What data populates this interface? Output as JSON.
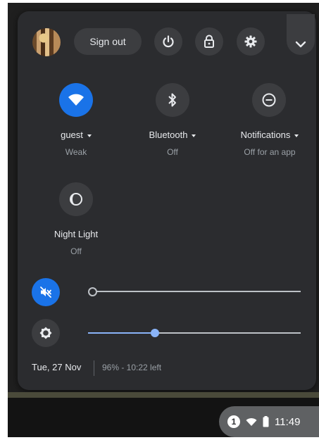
{
  "header": {
    "sign_out_label": "Sign out",
    "icons": [
      "avatar",
      "power-icon",
      "lock-icon",
      "gear-icon",
      "chevron-down-icon"
    ]
  },
  "features": [
    {
      "label": "guest",
      "status": "Weak",
      "icon": "wifi-icon",
      "active": true,
      "has_menu": true
    },
    {
      "label": "Bluetooth",
      "status": "Off",
      "icon": "bluetooth-icon",
      "active": false,
      "has_menu": true
    },
    {
      "label": "Notifications",
      "status": "Off for an app",
      "icon": "do-not-disturb-icon",
      "active": false,
      "has_menu": true
    },
    {
      "label": "Night Light",
      "status": "Off",
      "icon": "night-light-icon",
      "active": false,
      "has_menu": false
    }
  ],
  "sliders": {
    "volume": {
      "icon": "volume-muted-icon",
      "value": 0,
      "muted": true
    },
    "brightness": {
      "icon": "brightness-icon",
      "value": 0.32
    }
  },
  "footer": {
    "date": "Tue, 27 Nov",
    "battery": "96% - 10:22 left"
  },
  "shelf": {
    "notification_count": "1",
    "time": "11:49",
    "icons": [
      "wifi-status-icon",
      "battery-status-icon"
    ]
  },
  "colors": {
    "accent": "#1a73e8",
    "panel": "#2b2c2f",
    "button": "#3c3d40",
    "slider_active": "#8ab4f8"
  }
}
